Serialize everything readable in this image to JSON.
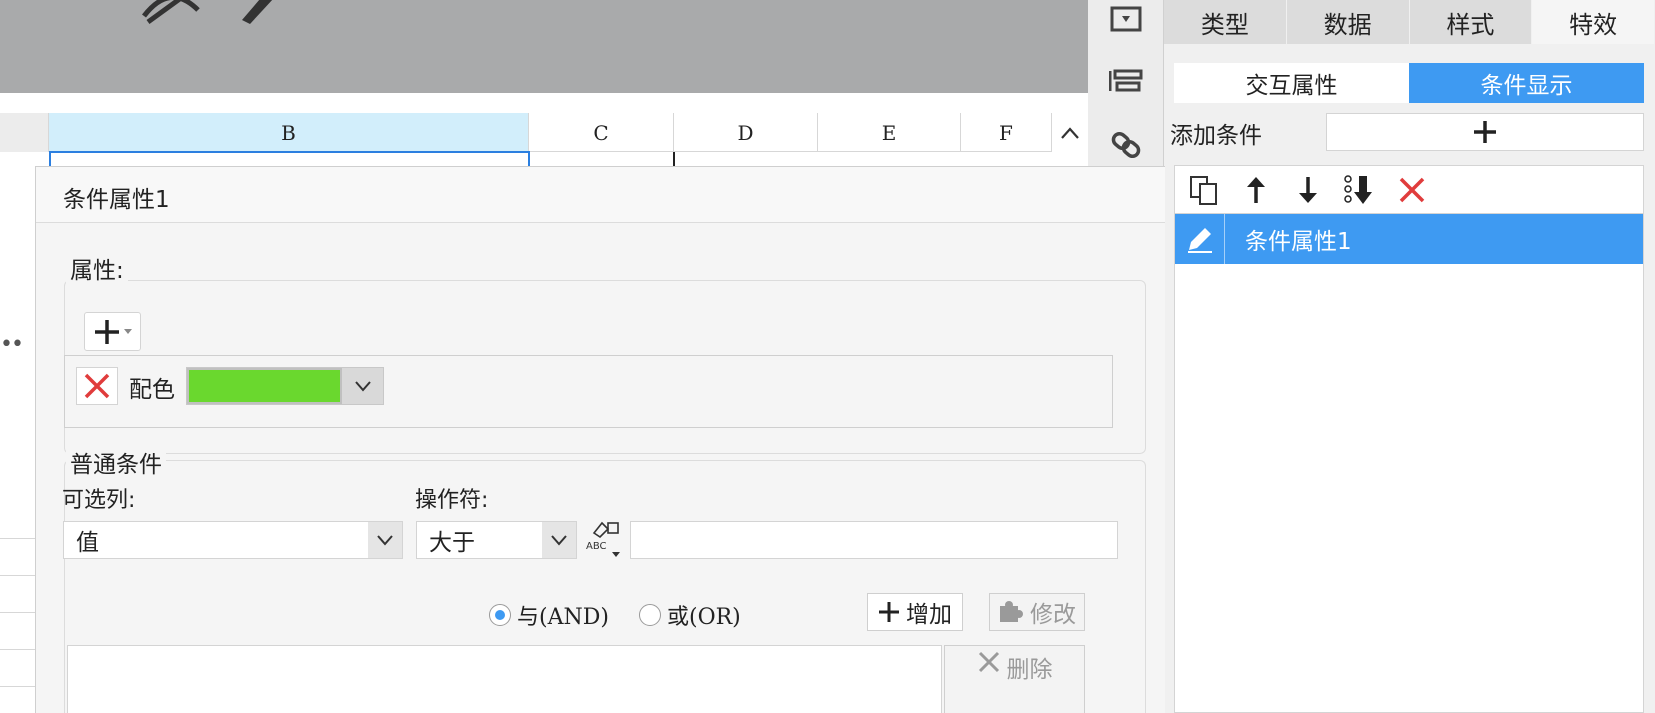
{
  "spreadsheet": {
    "columns": [
      "B",
      "C",
      "D",
      "E",
      "F"
    ]
  },
  "right_panel": {
    "main_tabs": [
      {
        "label": "类型",
        "active": false
      },
      {
        "label": "数据",
        "active": false
      },
      {
        "label": "样式",
        "active": false
      },
      {
        "label": "特效",
        "active": true
      }
    ],
    "sub_tabs": [
      {
        "label": "交互属性",
        "active": false
      },
      {
        "label": "条件显示",
        "active": true
      }
    ],
    "add_condition_label": "添加条件",
    "condition_items": [
      {
        "label": "条件属性1",
        "selected": true
      }
    ]
  },
  "dialog": {
    "title": "条件属性1",
    "properties": {
      "group_label": "属性:",
      "rows": [
        {
          "name": "配色",
          "color": "#6ad82e"
        }
      ]
    },
    "normal_condition": {
      "group_label": "普通条件",
      "column_label": "可选列:",
      "column_value": "值",
      "operator_label": "操作符:",
      "operator_value": "大于",
      "value_input": "",
      "radio_and": "与(AND)",
      "radio_or": "或(OR)",
      "selected_logic": "and",
      "add_button": "增加",
      "modify_button": "修改",
      "delete_button": "删除"
    }
  },
  "colors": {
    "accent": "#3e9af2",
    "selected_column": "#d2eefb",
    "toolbar_gray": "#a9aaab",
    "delete_red": "#e03c3c"
  }
}
